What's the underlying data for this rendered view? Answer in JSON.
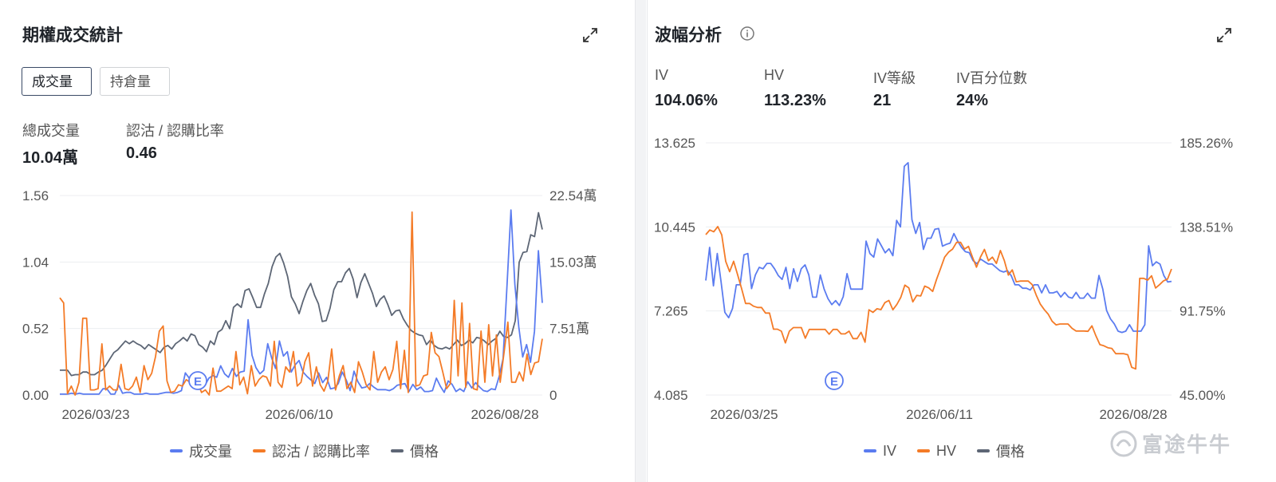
{
  "left": {
    "title": "期權成交統計",
    "tabs": [
      "成交量",
      "持倉量"
    ],
    "stats": [
      {
        "label": "總成交量",
        "value": "10.04萬"
      },
      {
        "label": "認沽 / 認購比率",
        "value": "0.46"
      }
    ],
    "legend": [
      "成交量",
      "認沽 / 認購比率",
      "價格"
    ]
  },
  "right": {
    "title": "波幅分析",
    "stats": [
      {
        "label": "IV",
        "value": "104.06%"
      },
      {
        "label": "HV",
        "value": "113.23%"
      },
      {
        "label": "IV等級",
        "value": "21"
      },
      {
        "label": "IV百分位數",
        "value": "24%"
      }
    ],
    "legend": [
      "IV",
      "HV",
      "價格"
    ]
  },
  "watermark": "富途牛牛",
  "colors": {
    "blue": "#5b7cf0",
    "orange": "#f47b27",
    "gray": "#5d6675",
    "grid": "#eceef1"
  },
  "chart_data": [
    {
      "type": "line",
      "x_ticks": [
        "2026/03/23",
        "2026/06/10",
        "2026/08/28"
      ],
      "left_axis": {
        "ticks": [
          "0.00",
          "0.52",
          "1.04",
          "1.56"
        ],
        "range": [
          0,
          1.56
        ]
      },
      "right_axis": {
        "ticks": [
          "0",
          "7.51萬",
          "15.03萬",
          "22.54萬"
        ],
        "range": [
          0,
          22.54
        ],
        "unit": "萬"
      },
      "event_marker": {
        "label": "E",
        "at": "2026/05/06"
      },
      "series": [
        {
          "name": "成交量",
          "axis": "right",
          "color": "#5b7cf0",
          "values": [
            0.1,
            0.1,
            0.1,
            0.2,
            0.1,
            0.2,
            0.1,
            0.1,
            0.1,
            0.1,
            0.1,
            0.7,
            0.7,
            0.1,
            0.1,
            1.1,
            0.2,
            0.3,
            0.3,
            0.1,
            0.1,
            0.1,
            0.2,
            0.1,
            0.1,
            0.1,
            0.2,
            0.3,
            0.3,
            0.2,
            0.3,
            0.5,
            2.5,
            1.9,
            1.6,
            1.1,
            2.1,
            1.1,
            1.9,
            2.2,
            2.0,
            3.3,
            2.4,
            2.0,
            3.0,
            2.1,
            2.6,
            2.7,
            8.5,
            4.5,
            3.1,
            2.4,
            2.8,
            5.8,
            4.2,
            3.0,
            6.1,
            4.4,
            4.9,
            2.6,
            3.4,
            3.9,
            2.6,
            2.1,
            1.7,
            1.3,
            2.5,
            1.4,
            2.0,
            0.7,
            0.8,
            1.3,
            2.6,
            1.7,
            0.5,
            2.7,
            1.5,
            0.8,
            0.9,
            1.3,
            0.9,
            0.6,
            0.6,
            0.6,
            0.5,
            0.7,
            1.1,
            1.2,
            1.3,
            0.4,
            1.2,
            0.6,
            0.9,
            0.4,
            0.4,
            0.5,
            1.9,
            1.0,
            0.3,
            1.6,
            1.2,
            0.4,
            0.7,
            0.4,
            1.5,
            0.8,
            1.4,
            0.9,
            0.5,
            0.4,
            0.7,
            0.6,
            2.1,
            4.1,
            12.3,
            20.9,
            12.5,
            7.7,
            4.3,
            5.7,
            3.7,
            7.2,
            16.3,
            10.4
          ]
        },
        {
          "name": "認沽 / 認購比率",
          "axis": "left",
          "color": "#f47b27",
          "values": [
            0.76,
            0.72,
            0.01,
            0.07,
            0.0,
            0.1,
            0.6,
            0.6,
            0.04,
            0.04,
            0.05,
            0.4,
            0.04,
            0.07,
            0.04,
            0.04,
            0.24,
            0.05,
            0.04,
            0.07,
            0.14,
            0.02,
            0.23,
            0.12,
            0.17,
            0.3,
            0.5,
            0.54,
            0.11,
            0.02,
            0.03,
            0.08,
            0.07,
            0.12,
            0.1,
            0.16,
            0.1,
            0.02,
            0.04,
            0.0,
            0.21,
            0.03,
            0.03,
            0.05,
            0.07,
            0.05,
            0.34,
            0.08,
            0.14,
            0.01,
            0.23,
            0.07,
            0.12,
            0.15,
            0.14,
            0.07,
            0.42,
            0.1,
            0.06,
            0.22,
            0.18,
            0.34,
            0.07,
            0.1,
            0.26,
            0.33,
            0.07,
            0.22,
            0.08,
            0.03,
            0.11,
            0.36,
            0.04,
            0.15,
            0.23,
            0.05,
            0.1,
            0.02,
            0.26,
            0.18,
            0.08,
            0.04,
            0.34,
            0.1,
            0.18,
            0.22,
            0.12,
            0.2,
            0.42,
            0.05,
            0.35,
            0.02,
            1.43,
            0.07,
            0.08,
            0.15,
            0.16,
            0.49,
            0.33,
            0.3,
            0.18,
            0.05,
            0.09,
            0.74,
            0.15,
            0.72,
            0.06,
            0.56,
            0.05,
            0.04,
            0.5,
            0.1,
            0.55,
            0.15,
            0.47,
            0.1,
            0.33,
            0.57,
            0.1,
            0.1,
            0.18,
            0.11,
            0.32,
            0.16,
            0.25,
            0.26,
            0.44
          ]
        },
        {
          "name": "價格",
          "axis": "right",
          "color": "#5d6675",
          "values": [
            2.8,
            2.8,
            2.8,
            2.2,
            2.3,
            2.3,
            2.6,
            2.6,
            2.3,
            2.3,
            2.6,
            2.8,
            3.4,
            4.1,
            4.8,
            5.1,
            5.6,
            6.1,
            5.8,
            6.1,
            5.8,
            5.6,
            5.2,
            5.7,
            5.4,
            5.1,
            4.8,
            5.4,
            5.6,
            5.2,
            5.8,
            6.1,
            6.5,
            6.1,
            6.9,
            6.7,
            5.7,
            5.4,
            4.9,
            6.1,
            5.7,
            7.1,
            7.4,
            8.4,
            7.5,
            9.9,
            10.3,
            9.9,
            11.8,
            12.0,
            11.0,
            9.9,
            9.9,
            11.4,
            12.6,
            14.5,
            15.6,
            16.0,
            14.9,
            13.4,
            11.1,
            10.3,
            9.2,
            10.6,
            11.8,
            12.6,
            11.3,
            10.3,
            8.3,
            8.4,
            9.8,
            11.9,
            12.8,
            12.8,
            13.8,
            14.3,
            13.1,
            11.0,
            12.7,
            13.7,
            12.6,
            11.5,
            10.0,
            10.8,
            11.2,
            10.2,
            9.0,
            9.5,
            9.6,
            8.6,
            7.9,
            7.3,
            7.0,
            6.8,
            6.7,
            5.7,
            6.2,
            5.6,
            5.3,
            5.2,
            5.4,
            5.2,
            5.7,
            6.2,
            5.6,
            5.8,
            6.2,
            5.9,
            6.5,
            6.4,
            6.1,
            5.7,
            6.1,
            6.4,
            7.2,
            6.6,
            6.5,
            6.8,
            8.4,
            15.0,
            16.1,
            16.2,
            18.1,
            17.9,
            20.6,
            18.7
          ]
        }
      ]
    },
    {
      "type": "line",
      "x_ticks": [
        "2026/03/25",
        "2026/06/11",
        "2026/08/28"
      ],
      "left_axis": {
        "ticks": [
          "4.085",
          "7.265",
          "10.445",
          "13.625"
        ],
        "range": [
          4.085,
          13.625
        ]
      },
      "right_axis": {
        "ticks": [
          "45.00%",
          "91.75%",
          "138.51%",
          "185.26%"
        ],
        "range": [
          45.0,
          185.26
        ],
        "unit": "%"
      },
      "event_marker": {
        "label": "E",
        "at": "2026/05/08"
      },
      "series": [
        {
          "name": "IV",
          "axis": "right",
          "color": "#5b7cf0",
          "values": [
            108.7,
            127.1,
            105.7,
            123.7,
            108.2,
            91.0,
            88.0,
            93.1,
            106.3,
            106.3,
            123.0,
            123.7,
            104.2,
            111.8,
            116.0,
            115.2,
            118.2,
            118.2,
            115.2,
            111.4,
            109.3,
            116.0,
            104.2,
            115.2,
            108.2,
            115.2,
            117.4,
            111.8,
            99.4,
            99.4,
            111.8,
            103.9,
            98.6,
            95.3,
            97.5,
            94.8,
            99.7,
            112.5,
            103.9,
            103.9,
            103.9,
            103.9,
            130.6,
            123.7,
            121.7,
            131.8,
            128.0,
            124.1,
            126.3,
            122.5,
            142.1,
            138.5,
            172.2,
            174.2,
            142.5,
            134.9,
            140.9,
            126.0,
            132.2,
            132.2,
            137.2,
            137.6,
            127.8,
            128.8,
            129.5,
            134.8,
            130.6,
            127.1,
            124.7,
            124.2,
            119.8,
            118.0,
            120.6,
            119.2,
            117.9,
            117.9,
            116.0,
            114.2,
            113.4,
            114.2,
            111.4,
            106.3,
            106.3,
            104.4,
            104.4,
            103.4,
            106.3,
            106.3,
            101.8,
            106.3,
            101.8,
            101.8,
            102.6,
            99.5,
            102.1,
            99.5,
            98.9,
            102.1,
            98.9,
            98.9,
            101.6,
            98.9,
            98.9,
            111.5,
            103.9,
            92.0,
            87.4,
            84.6,
            80.5,
            79.8,
            80.5,
            84.1,
            80.5,
            80.5,
            80.5,
            84.1,
            128.0,
            116.9,
            119.1,
            117.8,
            111.4,
            107.9,
            108.2
          ]
        },
        {
          "name": "HV",
          "axis": "right",
          "color": "#f47b27",
          "values": [
            134.2,
            136.8,
            135.8,
            138.7,
            134.1,
            119.3,
            113.6,
            119.4,
            111.9,
            104.2,
            95.9,
            95.9,
            94.4,
            93.7,
            93.7,
            90.6,
            90.6,
            81.6,
            81.6,
            80.5,
            74.0,
            80.5,
            82.5,
            82.5,
            82.5,
            76.6,
            81.5,
            81.5,
            81.5,
            81.5,
            81.5,
            78.8,
            81.5,
            81.5,
            79.0,
            79.0,
            80.5,
            76.4,
            76.4,
            79.9,
            74.4,
            92.4,
            91.0,
            93.0,
            92.5,
            96.4,
            97.6,
            92.4,
            95.4,
            99.4,
            106.1,
            104.6,
            96.8,
            100.4,
            100.1,
            105.6,
            104.6,
            102.6,
            109.5,
            115.5,
            121.7,
            124.5,
            126.2,
            129.9,
            129.9,
            126.2,
            127.7,
            121.7,
            116.1,
            121.7,
            126.0,
            119.7,
            121.7,
            118.2,
            125.4,
            119.7,
            111.7,
            114.6,
            108.0,
            108.4,
            108.4,
            108.4,
            106.4,
            100.6,
            95.7,
            92.6,
            90.0,
            86.0,
            84.0,
            84.5,
            84.5,
            84.5,
            82.1,
            80.6,
            80.6,
            80.6,
            80.4,
            83.5,
            77.9,
            73.0,
            72.4,
            71.3,
            70.9,
            68.0,
            68.0,
            68.0,
            67.4,
            60.4,
            59.5,
            109.9,
            109.9,
            108.9,
            111.3,
            104.5,
            106.4,
            108.5,
            109.5,
            115.1
          ]
        },
        {
          "name": "價格",
          "axis": "right",
          "color": "#5d6675",
          "values": [
            6.0,
            5.5,
            5.6,
            5.5,
            5.8,
            5.8,
            5.5,
            5.6,
            5.8,
            6.3,
            6.6,
            6.9,
            7.1,
            7.3,
            7.2,
            7.3,
            6.8,
            6.5,
            6.6,
            6.8,
            6.6,
            6.8,
            7.1,
            6.9,
            7.2,
            7.3,
            7.5,
            7.2,
            7.0,
            6.9,
            6.5,
            6.8,
            6.6,
            7.6,
            7.6,
            7.4,
            7.5,
            8.5,
            9.0,
            9.0,
            8.5,
            9.0,
            9.8,
            10.5,
            10.6,
            10.3,
            10.0,
            9.2,
            8.5,
            8.7,
            9.2,
            9.4,
            9.8,
            10.2,
            10.1,
            10.6,
            10.4,
            10.1,
            10.2,
            10.1,
            9.6,
            9.0,
            9.0,
            9.3,
            9.2,
            9.2,
            8.9,
            8.6,
            8.4,
            8.1,
            8.1,
            8.0,
            8.4,
            8.4,
            8.1,
            8.4,
            8.4,
            8.1,
            8.1,
            7.8,
            7.5,
            7.3,
            7.2,
            7.0,
            7.1,
            7.0,
            7.0,
            7.0,
            7.3,
            7.4,
            7.2,
            7.2,
            7.1,
            7.1,
            6.9,
            6.8,
            6.7,
            6.4,
            6.8,
            7.1,
            7.3,
            7.3,
            7.6,
            7.6,
            7.7,
            7.8,
            7.8,
            7.6,
            7.8,
            7.6,
            7.6,
            7.6,
            7.8,
            8.0,
            9.2,
            9.5,
            10.4,
            10.4,
            11.5,
            11.2,
            11.8,
            12.6,
            11.5
          ]
        }
      ]
    }
  ]
}
